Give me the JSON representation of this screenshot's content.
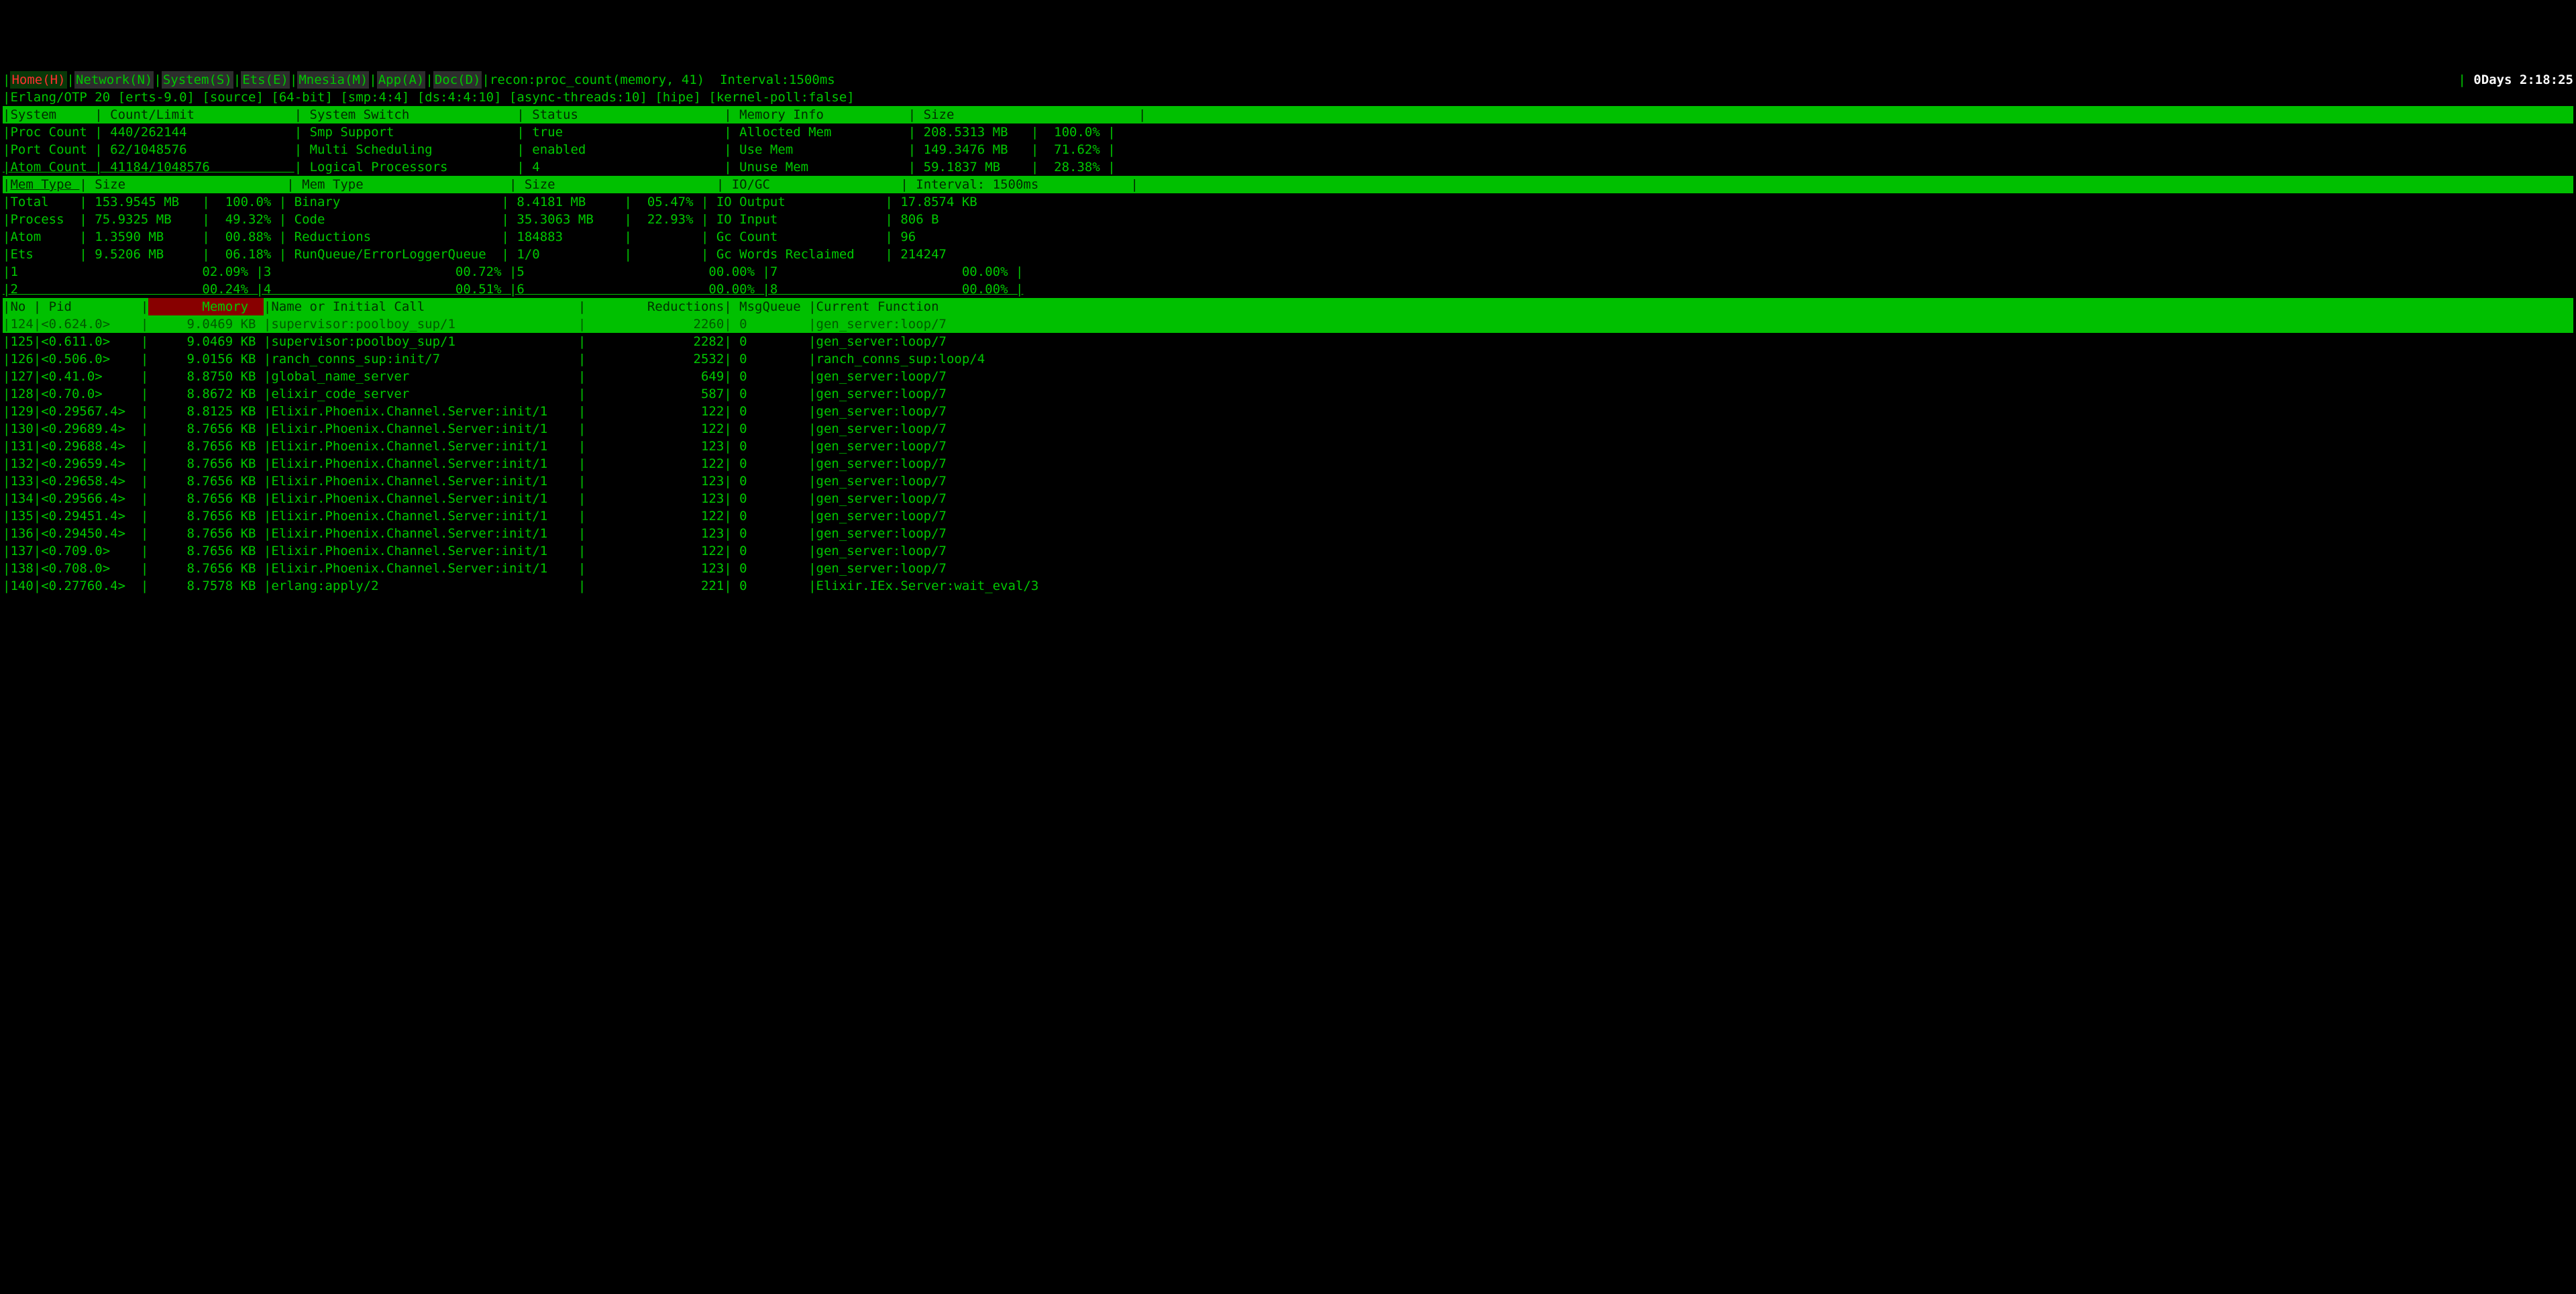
{
  "menu": {
    "home": "Home(H)",
    "network": "Network(N)",
    "system": "System(S)",
    "ets": "Ets(E)",
    "mnesia": "Mnesia(M)",
    "app": "App(A)",
    "doc": "Doc(D)"
  },
  "status_cmd": "recon:proc_count(memory, 41)",
  "interval_label": "Interval:1500ms",
  "uptime": "0Days 2:18:25",
  "version": "Erlang/OTP 20 [erts-9.0] [source] [64-bit] [smp:4:4] [ds:4:4:10] [async-threads:10] [hipe] [kernel-poll:false]",
  "hdr1": {
    "system": "System",
    "count_limit": "Count/Limit",
    "switch": "System Switch",
    "status": "Status",
    "mem_info": "Memory Info",
    "size": "Size"
  },
  "sys_rows": [
    {
      "k": "Proc Count",
      "v": "440/262144",
      "sw": "Smp Support",
      "st": "true",
      "mi": "Allocted Mem",
      "sz": "208.5313 MB",
      "pct": "100.0%"
    },
    {
      "k": "Port Count",
      "v": "62/1048576",
      "sw": "Multi Scheduling",
      "st": "enabled",
      "mi": "Use Mem",
      "sz": "149.3476 MB",
      "pct": "71.62%"
    },
    {
      "k": "Atom Count",
      "v": "41184/1048576",
      "sw": "Logical Processors",
      "st": "4",
      "mi": "Unuse Mem",
      "sz": "59.1837 MB",
      "pct": "28.38%"
    }
  ],
  "hdr2": {
    "mem_type1": "Mem Type",
    "size1": "Size",
    "mem_type2": "Mem Type",
    "size2": "Size",
    "iogc": "IO/GC",
    "interval": "Interval: 1500ms"
  },
  "mem_rows": [
    {
      "a": "Total",
      "asz": "153.9545 MB",
      "apct": "100.0%",
      "b": "Binary",
      "bsz": "8.4181 MB",
      "bpct": "05.47%",
      "io": "IO Output",
      "iov": "17.8574 KB"
    },
    {
      "a": "Process",
      "asz": "75.9325 MB",
      "apct": "49.32%",
      "b": "Code",
      "bsz": "35.3063 MB",
      "bpct": "22.93%",
      "io": "IO Input",
      "iov": "806 B"
    },
    {
      "a": "Atom",
      "asz": "1.3590 MB",
      "apct": "00.88%",
      "b": "Reductions",
      "bsz": "184883",
      "bpct": "",
      "io": "Gc Count",
      "iov": "96"
    },
    {
      "a": "Ets",
      "asz": "9.5206 MB",
      "apct": "06.18%",
      "b": "RunQueue/ErrorLoggerQueue",
      "bsz": "1/0",
      "bpct": "",
      "io": "Gc Words Reclaimed",
      "iov": "214247"
    }
  ],
  "sched": [
    {
      "n": "1",
      "p": "02.09%"
    },
    {
      "n": "3",
      "p": "00.72%"
    },
    {
      "n": "5",
      "p": "00.00%"
    },
    {
      "n": "7",
      "p": "00.00%"
    },
    {
      "n": "2",
      "p": "00.24%"
    },
    {
      "n": "4",
      "p": "00.51%"
    },
    {
      "n": "6",
      "p": "00.00%"
    },
    {
      "n": "8",
      "p": "00.00%"
    }
  ],
  "proc_hdr": {
    "no": "No",
    "pid": "Pid",
    "memory": "Memory",
    "name": "Name or Initial Call",
    "reductions": "Reductions",
    "msgq": "MsgQueue",
    "curfun": "Current Function"
  },
  "procs": [
    {
      "no": "124",
      "pid": "<0.624.0>",
      "mem": "9.0469 KB",
      "name": "supervisor:poolboy_sup/1",
      "red": "2260",
      "mq": "0",
      "cf": "gen_server:loop/7",
      "hl": true
    },
    {
      "no": "125",
      "pid": "<0.611.0>",
      "mem": "9.0469 KB",
      "name": "supervisor:poolboy_sup/1",
      "red": "2282",
      "mq": "0",
      "cf": "gen_server:loop/7"
    },
    {
      "no": "126",
      "pid": "<0.506.0>",
      "mem": "9.0156 KB",
      "name": "ranch_conns_sup:init/7",
      "red": "2532",
      "mq": "0",
      "cf": "ranch_conns_sup:loop/4"
    },
    {
      "no": "127",
      "pid": "<0.41.0>",
      "mem": "8.8750 KB",
      "name": "global_name_server",
      "red": "649",
      "mq": "0",
      "cf": "gen_server:loop/7"
    },
    {
      "no": "128",
      "pid": "<0.70.0>",
      "mem": "8.8672 KB",
      "name": "elixir_code_server",
      "red": "587",
      "mq": "0",
      "cf": "gen_server:loop/7"
    },
    {
      "no": "129",
      "pid": "<0.29567.4>",
      "mem": "8.8125 KB",
      "name": "Elixir.Phoenix.Channel.Server:init/1",
      "red": "122",
      "mq": "0",
      "cf": "gen_server:loop/7"
    },
    {
      "no": "130",
      "pid": "<0.29689.4>",
      "mem": "8.7656 KB",
      "name": "Elixir.Phoenix.Channel.Server:init/1",
      "red": "122",
      "mq": "0",
      "cf": "gen_server:loop/7"
    },
    {
      "no": "131",
      "pid": "<0.29688.4>",
      "mem": "8.7656 KB",
      "name": "Elixir.Phoenix.Channel.Server:init/1",
      "red": "123",
      "mq": "0",
      "cf": "gen_server:loop/7"
    },
    {
      "no": "132",
      "pid": "<0.29659.4>",
      "mem": "8.7656 KB",
      "name": "Elixir.Phoenix.Channel.Server:init/1",
      "red": "122",
      "mq": "0",
      "cf": "gen_server:loop/7"
    },
    {
      "no": "133",
      "pid": "<0.29658.4>",
      "mem": "8.7656 KB",
      "name": "Elixir.Phoenix.Channel.Server:init/1",
      "red": "123",
      "mq": "0",
      "cf": "gen_server:loop/7"
    },
    {
      "no": "134",
      "pid": "<0.29566.4>",
      "mem": "8.7656 KB",
      "name": "Elixir.Phoenix.Channel.Server:init/1",
      "red": "123",
      "mq": "0",
      "cf": "gen_server:loop/7"
    },
    {
      "no": "135",
      "pid": "<0.29451.4>",
      "mem": "8.7656 KB",
      "name": "Elixir.Phoenix.Channel.Server:init/1",
      "red": "122",
      "mq": "0",
      "cf": "gen_server:loop/7"
    },
    {
      "no": "136",
      "pid": "<0.29450.4>",
      "mem": "8.7656 KB",
      "name": "Elixir.Phoenix.Channel.Server:init/1",
      "red": "123",
      "mq": "0",
      "cf": "gen_server:loop/7"
    },
    {
      "no": "137",
      "pid": "<0.709.0>",
      "mem": "8.7656 KB",
      "name": "Elixir.Phoenix.Channel.Server:init/1",
      "red": "122",
      "mq": "0",
      "cf": "gen_server:loop/7"
    },
    {
      "no": "138",
      "pid": "<0.708.0>",
      "mem": "8.7656 KB",
      "name": "Elixir.Phoenix.Channel.Server:init/1",
      "red": "123",
      "mq": "0",
      "cf": "gen_server:loop/7"
    },
    {
      "no": "140",
      "pid": "<0.27760.4>",
      "mem": "8.7578 KB",
      "name": "erlang:apply/2",
      "red": "221",
      "mq": "0",
      "cf": "Elixir.IEx.Server:wait_eval/3"
    }
  ]
}
